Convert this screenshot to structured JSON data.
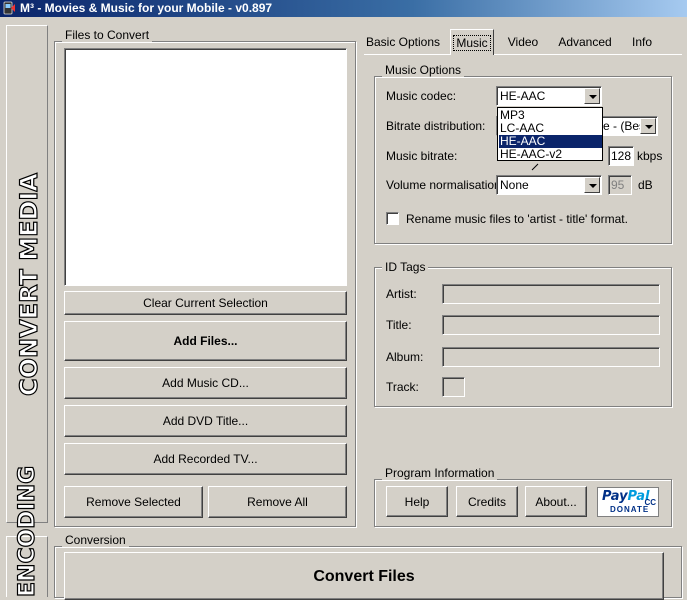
{
  "window": {
    "title": "M³ - Movies & Music for your Mobile - v0.897"
  },
  "sidebar": {
    "label": "CONVERT MEDIA",
    "second_label": "ENCODING"
  },
  "files_panel": {
    "label": "Files to Convert",
    "buttons": {
      "clear": "Clear Current Selection",
      "add_files": "Add Files...",
      "add_cd": "Add Music CD...",
      "add_dvd": "Add DVD Title...",
      "add_tv": "Add Recorded TV...",
      "remove_selected": "Remove Selected",
      "remove_all": "Remove All"
    }
  },
  "tabs": [
    "Basic Options",
    "Music",
    "Video",
    "Advanced",
    "Info"
  ],
  "active_tab": "Music",
  "music_options": {
    "label": "Music Options",
    "codec_label": "Music codec:",
    "codec_value": "HE-AAC",
    "codec_options": [
      "MP3",
      "LC-AAC",
      "HE-AAC",
      "HE-AAC-v2"
    ],
    "bitrate_dist_label": "Bitrate distribution:",
    "bitrate_dist_value": "e - (Best",
    "bitrate_label": "Music bitrate:",
    "bitrate_value": "128",
    "bitrate_unit": "kbps",
    "volume_label": "Volume normalisation:",
    "volume_value": "None",
    "volume_level": "95",
    "volume_unit": "dB",
    "rename_label": "Rename music files to 'artist - title' format.",
    "rename_checked": false
  },
  "id_tags": {
    "label": "ID Tags",
    "artist_label": "Artist:",
    "title_label": "Title:",
    "album_label": "Album:",
    "track_label": "Track:"
  },
  "program_info": {
    "label": "Program Information",
    "help": "Help",
    "credits": "Credits",
    "about": "About...",
    "paypal_a": "Pay",
    "paypal_b": "Pal",
    "donate": "DONATE",
    "cc": "CC"
  },
  "conversion": {
    "label": "Conversion",
    "convert_button": "Convert Files"
  }
}
